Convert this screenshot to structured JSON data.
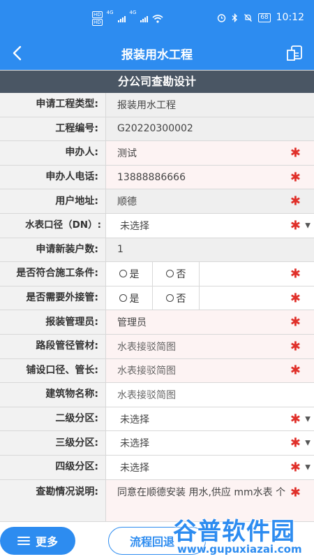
{
  "status_bar": {
    "time": "10:12",
    "battery": "68",
    "sim1_tag": "HD",
    "sim2_tag": "HD",
    "network": "4G",
    "icons": [
      "signal-icon",
      "wifi-icon",
      "alarm-icon",
      "bluetooth-icon",
      "mute-icon",
      "battery-icon"
    ]
  },
  "nav": {
    "title": "报装用水工程",
    "back_icon": "chevron-left-icon",
    "right_icon": "document-icon"
  },
  "section": {
    "title": "分公司查勘设计"
  },
  "rows": [
    {
      "label": "申请工程类型:",
      "value": "报装用水工程"
    },
    {
      "label": "工程编号:",
      "value": "G20220300002"
    },
    {
      "label": "申办人:",
      "value": "测试",
      "required": "✱"
    },
    {
      "label": "申办人电话:",
      "value": "13888886666",
      "required": "✱"
    },
    {
      "label": "用户地址:",
      "value": "顺德",
      "required": "✱"
    },
    {
      "label": "水表口径（DN）:",
      "value": "未选择",
      "required": "✱",
      "caret": "▼"
    },
    {
      "label": "申请新装户数:",
      "value": "1"
    },
    {
      "label": "是否符合施工条件:",
      "option_yes": "是",
      "option_no": "否",
      "required": "✱"
    },
    {
      "label": "是否需要外接管:",
      "option_yes": "是",
      "option_no": "否",
      "required": "✱"
    },
    {
      "label": "报装管理员:",
      "value": "管理员",
      "required": "✱"
    },
    {
      "label": "路段管径管材:",
      "placeholder": "水表接驳简图",
      "required": "✱"
    },
    {
      "label": "铺设口径、管长:",
      "placeholder": "水表接驳简图",
      "required": "✱"
    },
    {
      "label": "建筑物名称:",
      "placeholder": "水表接驳简图"
    },
    {
      "label": "二级分区:",
      "value": "未选择",
      "required": "✱",
      "caret": "▼"
    },
    {
      "label": "三级分区:",
      "value": "未选择",
      "required": "✱",
      "caret": "▼"
    },
    {
      "label": "四级分区:",
      "value": "未选择",
      "required": "✱",
      "caret": "▼"
    },
    {
      "label": "查勘情况说明:",
      "value": "同意在顺德安装 用水,供应 mm水表 个",
      "required": "✱"
    }
  ],
  "bottom": {
    "more_label": "更多",
    "more_icon": "menu-icon",
    "flow_label": "流程回退"
  },
  "watermark": {
    "text": "谷普软件园",
    "url": "www.gupuxiazai.com"
  },
  "colors": {
    "primary": "#2d8cf0",
    "section_bg": "#4a5664",
    "required": "#e0302a",
    "pink_field": "#fdf3f3"
  }
}
